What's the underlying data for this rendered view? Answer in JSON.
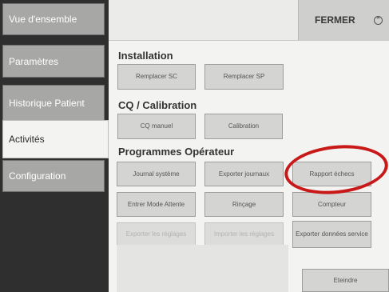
{
  "sidebar": {
    "items": [
      {
        "label": "Vue d'ensemble"
      },
      {
        "label": "Paramètres"
      },
      {
        "label": "Historique Patient"
      },
      {
        "label": "Activités"
      },
      {
        "label": "Configuration"
      }
    ]
  },
  "header": {
    "close_label": "FERMER",
    "close_icon": "chevron-up-icon"
  },
  "sections": [
    {
      "title": "Installation",
      "buttons": [
        "Remplacer SC",
        "Remplacer SP"
      ]
    },
    {
      "title": "CQ / Calibration",
      "buttons": [
        "CQ manuel",
        "Calibration"
      ]
    },
    {
      "title": "Programmes Opérateur",
      "buttons": [
        "Journal système",
        "Exporter journaux",
        "Rapport échecs",
        "Entrer Mode Attente",
        "Rinçage",
        "Compteur",
        "Exporter les réglages",
        "Importer les réglages",
        "Exporter données service"
      ]
    }
  ],
  "footer": {
    "power_label": "Eteindre"
  },
  "colors": {
    "annotation": "#c81818",
    "sidebar_bg": "#2f2f2f",
    "tab_bg": "#a7a7a6"
  }
}
